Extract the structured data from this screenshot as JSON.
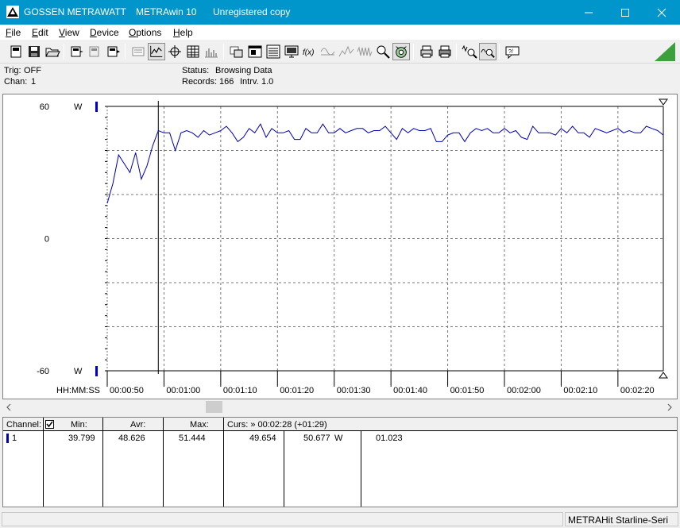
{
  "window": {
    "brand": "GOSSEN METRAWATT",
    "app_name": "METRAwin 10",
    "registration": "Unregistered copy",
    "minimize_icon": "minimize-icon",
    "maximize_icon": "maximize-icon",
    "close_icon": "close-icon"
  },
  "menu": [
    {
      "label": "File",
      "key": "F",
      "rest": "ile"
    },
    {
      "label": "Edit",
      "key": "E",
      "rest": "dit"
    },
    {
      "label": "View",
      "key": "V",
      "rest": "iew"
    },
    {
      "label": "Device",
      "key": "D",
      "rest": "evice"
    },
    {
      "label": "Options",
      "key": "O",
      "rest": "ptions"
    },
    {
      "label": "Help",
      "key": "H",
      "rest": "elp"
    }
  ],
  "info": {
    "trig_label": "Trig:",
    "trig_value": "OFF",
    "chan_label": "Chan:",
    "chan_value": "1",
    "status_label": "Status:",
    "status_value": "Browsing Data",
    "records_label": "Records:",
    "records_value": "166",
    "intrv_label": "Intrv.",
    "intrv_value": "1.0"
  },
  "chart_data": {
    "type": "line",
    "y_unit": "W",
    "ylim": [
      -60,
      60
    ],
    "y_ticks": [
      60,
      0,
      -60
    ],
    "x_axis_label": "HH:MM:SS",
    "x_tick_labels": [
      "00:00:50",
      "00:01:00",
      "00:01:10",
      "00:01:20",
      "00:01:30",
      "00:01:40",
      "00:01:50",
      "00:02:00",
      "00:02:10",
      "00:02:20"
    ],
    "x_start_seconds": 50,
    "x_end_seconds": 148,
    "grid": true,
    "series": [
      {
        "color": "#0000b4",
        "x": [
          50,
          51,
          52,
          53,
          54,
          55,
          56,
          57,
          58,
          59,
          60,
          61,
          62,
          63,
          64,
          65,
          66,
          67,
          68,
          69,
          70,
          71,
          72,
          73,
          74,
          75,
          76,
          77,
          78,
          79,
          80,
          81,
          82,
          83,
          84,
          85,
          86,
          87,
          88,
          89,
          90,
          91,
          92,
          93,
          94,
          95,
          96,
          97,
          98,
          99,
          100,
          101,
          102,
          103,
          104,
          105,
          106,
          107,
          108,
          109,
          110,
          111,
          112,
          113,
          114,
          115,
          116,
          117,
          118,
          119,
          120,
          121,
          122,
          123,
          124,
          125,
          126,
          127,
          128,
          129,
          130,
          131,
          132,
          133,
          134,
          135,
          136,
          137,
          138,
          139,
          140,
          141,
          142,
          143,
          144,
          145,
          146,
          147,
          148
        ],
        "values": [
          16,
          25,
          38,
          34,
          30,
          39,
          27,
          33,
          42,
          49,
          48,
          48,
          40,
          48,
          49,
          48,
          46,
          49,
          47,
          48,
          49,
          51,
          48,
          44,
          46,
          50,
          48,
          52,
          46,
          50,
          48,
          48,
          49,
          45,
          45,
          50,
          48,
          48,
          52,
          48,
          48,
          50,
          48,
          49,
          50,
          50,
          48,
          49,
          49,
          51,
          48,
          45,
          50,
          48,
          50,
          49,
          49,
          50,
          44,
          44,
          47,
          48,
          48,
          44,
          48,
          50,
          49,
          50,
          48,
          48,
          50,
          48,
          49,
          46,
          45,
          51,
          48,
          48,
          48,
          47,
          50,
          48,
          51,
          48,
          48,
          46,
          50,
          49,
          48,
          49,
          50,
          48,
          49,
          48,
          48,
          51,
          50,
          49,
          47
        ]
      }
    ],
    "cursor_x": 59
  },
  "table": {
    "headers": {
      "channel": "Channel:",
      "min": "Min:",
      "avr": "Avr:",
      "max": "Max:",
      "curs": "Curs: » 00:02:28 (+01:29)"
    },
    "rows": [
      {
        "channel": "1",
        "min": "39.799",
        "avr": "48.626",
        "max": "51.444",
        "c1": "49.654",
        "c2": "50.677",
        "unit": "W",
        "c3": "01.023"
      }
    ]
  },
  "statusbar": {
    "device": "METRAHit Starline-Seri"
  }
}
